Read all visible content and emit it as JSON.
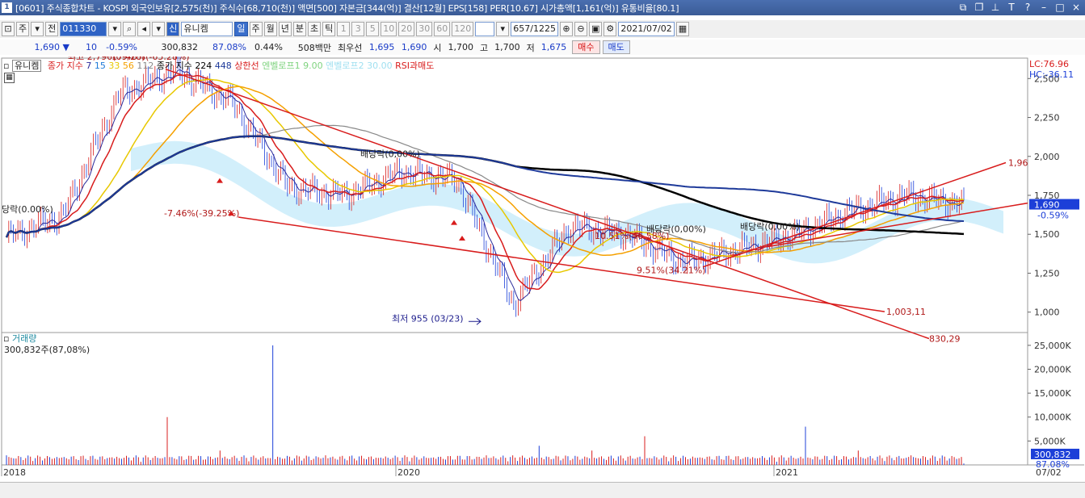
{
  "window": {
    "title": "[0601] 주식종합차트 - KOSPI 외국인보유[2,575(천)] 주식수[68,710(천)] 액면[500] 자본금[344(억)] 결산[12월] EPS[158] PER[10.67] 시가총액[1,161(억)] 유통비율[80.1]",
    "icon_label": "1"
  },
  "toolbar": {
    "period_select": "주",
    "prev_label": "전",
    "code": "011330",
    "market_badge": "신",
    "stock_name": "유니켐",
    "timeframes": [
      "일",
      "주",
      "월",
      "년",
      "분",
      "초",
      "틱"
    ],
    "active_timeframe": "일",
    "intervals": [
      "1",
      "3",
      "5",
      "10",
      "20",
      "30",
      "60",
      "120"
    ],
    "count_display": "657",
    "count_total": "/1225",
    "date": "2021/07/02"
  },
  "quote": {
    "price": "1,690",
    "change_arrow": "▼",
    "change": "10",
    "change_pct": "-0.59%",
    "volume": "300,832",
    "volume_ratio": "87.08%",
    "turnover": "0.44%",
    "amount": "508백만",
    "best_ask_label": "최우선",
    "best_ask": "1,695",
    "best_bid": "1,690",
    "open_label": "시",
    "open": "1,700",
    "high_label": "고",
    "high": "1,700",
    "low_label": "저",
    "low": "1,675",
    "buy_label": "매수",
    "sell_label": "매도"
  },
  "price_legend": {
    "stock": "유니켐",
    "ma_label": "종가 지수",
    "ma_periods": [
      "7",
      "15",
      "33",
      "56",
      "112"
    ],
    "ma2_label": "종가 지수",
    "ma2_periods": [
      "224",
      "448"
    ],
    "upper_limit": "상한선",
    "bollinger1": "엔벨로프1 9.00",
    "bollinger2": "엔벨로프2 30.00",
    "rsi": "RSI과매도",
    "lc_label": "LC:76.96",
    "hc_label": "HC:-36.11"
  },
  "volume_legend": {
    "title": "거래량",
    "current": "300,832주(87,08%)"
  },
  "annotations": {
    "high": "최고 2,790(09/28)",
    "high_overlap": "ㅡ17.46%(-65.28%)",
    "low": "최저 955 (03/23)",
    "left_dividend": "당락(0.00%)",
    "mid_dividend": "배당락(0,00%)",
    "right_dividend1": "배당락(0,00%)",
    "right_dividend2": "배당락(0,00%)",
    "pct1": "-7.46%(-39.25%)",
    "pct2": "10.51%(46.58%)",
    "pct3": "9.51%(34.21%)",
    "line1": "1,96",
    "line2": "1,003,11",
    "line3": "830,29"
  },
  "price_axis": {
    "ticks": [
      "2,500",
      "2,250",
      "2,000",
      "1,750",
      "1,500",
      "1,250",
      "1,000"
    ],
    "current_price": "1,690",
    "current_change": "-0.59%"
  },
  "volume_axis": {
    "ticks": [
      "25,000K",
      "20,000K",
      "15,000K",
      "10,000K",
      "5,000K"
    ],
    "current_volume": "300,832",
    "current_pct": "87.08%"
  },
  "time_axis": {
    "labels": [
      "2018",
      "2020",
      "2021"
    ],
    "end_label": "07/02"
  },
  "colors": {
    "up": "#d81c1c",
    "down": "#1c3fd8",
    "ma7": "#2a2a9a",
    "ma15": "#d81c1c",
    "ma33": "#e8c800",
    "ma56": "#f5a000",
    "ma112": "#888888",
    "ma224": "#000000",
    "ma448": "#1e3a9a",
    "cloud": "#b4e4f8",
    "trend": "#d81c1c"
  },
  "chart_data": {
    "type": "line",
    "title": "유니켐",
    "x": [
      "2018",
      "2020",
      "2021"
    ],
    "series": [
      {
        "name": "유니켐",
        "values": [
          1480,
          1620,
          2400,
          2550,
          2350,
          1800,
          1750,
          1900,
          1850,
          1050,
          1550,
          1500,
          1320,
          1400,
          1500,
          1650,
          1750,
          1690
        ]
      }
    ],
    "ylim": [
      900,
      2600
    ],
    "volume": [
      2,
      3,
      4,
      10,
      3,
      25,
      2,
      3,
      5,
      2,
      4,
      3,
      6,
      2,
      3,
      8,
      3,
      2,
      0.3
    ]
  }
}
